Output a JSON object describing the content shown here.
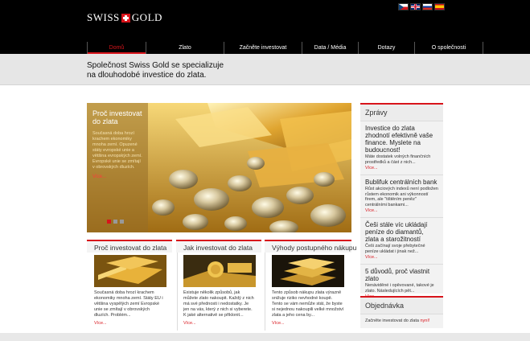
{
  "brand": {
    "logo_left": "Swiss",
    "logo_right": "Gold"
  },
  "languages": [
    "cz",
    "en",
    "ru",
    "es"
  ],
  "nav": [
    {
      "label": "Domů",
      "active": true
    },
    {
      "label": "Zlato"
    },
    {
      "label": "Začněte investovat"
    },
    {
      "label": "Data / Média"
    },
    {
      "label": "Dotazy"
    },
    {
      "label": "O společnosti"
    }
  ],
  "intro": {
    "line1": "Společnost Swiss Gold se specializuje",
    "line2": "na dlouhodobé investice do zlata."
  },
  "hero": {
    "title": "Proč investovat do zlata",
    "text": "Současná doba hrozí krachem ekonomiky mnoha zemí. Opuzené státy evropské unie a většina evropských zemí. Evropské unie se zmítají v obrovských dluzích.",
    "more": "Více..."
  },
  "columns": [
    {
      "title": "Proč investovat do zlata",
      "text": "Současná doba hrozí krachem ekonomiky mnoha zemí. Státy EU i většina vyspělých zemí Evropské unie se zmítají v obrovských dluzích. Problém...",
      "more": "Více..."
    },
    {
      "title": "Jak investovat do zlata",
      "text": "Existuje několik způsobů, jak můžete zlato nakoupit. Každý z nich má své přednosti i nedostatky. Je jen na vás, který z nich si vyberete. K jaké alternativě se přiklonit...",
      "more": "Více..."
    },
    {
      "title": "Výhody postupného nákupu",
      "text": "Tento způsob nákupu zlata výrazně snižuje riziko nevhodné koupě. Tento se vám nemůže stát, že byste si nejednou nakoupili velké množství zlata a jeho cena by...",
      "more": "Více..."
    }
  ],
  "news": {
    "title": "Zprávy",
    "items": [
      {
        "headline": "Investice do zlata zhodnotí efektivně vaše finance. Myslete na budoucnost!",
        "text": "Máte dostatek volných finančních prostředků a část z nich...",
        "more": "Více..."
      },
      {
        "headline": "Bublifuk centrálních bank",
        "text": "Růst akciových indexů není podložen růstem ekonomik ani výkonností firem, ale \"tištěním peněz\" centrálními bankami...",
        "more": "Více..."
      },
      {
        "headline": "Češi stále víc ukládají peníze do diamantů, zlata a starožitností",
        "text": "Češi začínají svoje přebytečné peníze ukládat i jinak než...",
        "more": "Více..."
      },
      {
        "headline": "5 důvodů, proč vlastnit zlato",
        "text": "Nenáviděné i opěvované, takové je zlato. Následujících pět...",
        "more": "Více..."
      }
    ]
  },
  "order": {
    "title": "Objednávka",
    "text": "Začněte investovat do zlata",
    "link": "nyní!"
  },
  "colors": {
    "accent": "#d8141b",
    "header_bg": "#000000",
    "gold": "#c99a2e"
  }
}
